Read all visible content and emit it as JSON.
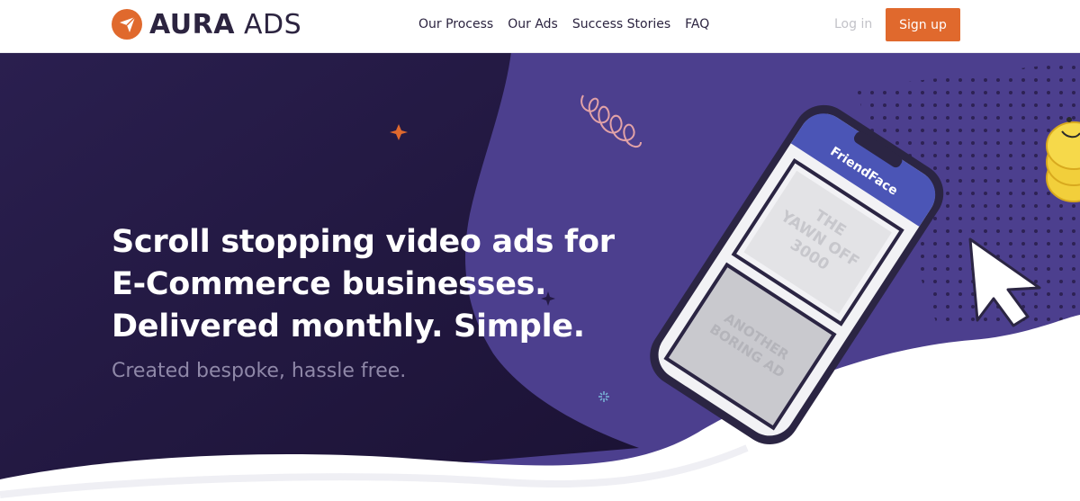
{
  "brand": {
    "name_bold": "AURA",
    "name_light": " ADS",
    "logo_icon": "paper-plane-icon",
    "accent": "#e0692d"
  },
  "nav": {
    "links": [
      {
        "label": "Our Process"
      },
      {
        "label": "Our Ads"
      },
      {
        "label": "Success Stories"
      },
      {
        "label": "FAQ"
      }
    ],
    "login_label": "Log in",
    "signup_label": "Sign up"
  },
  "hero": {
    "title_lines": [
      "Scroll stopping video ads for",
      "E-Commerce businesses.",
      "Delivered monthly. Simple."
    ],
    "subtitle": "Created bespoke, hassle free.",
    "colors": {
      "dark": "#21173f",
      "purple": "#4c3f8e",
      "button": "#e0692d"
    }
  },
  "phone": {
    "app_name": "FriendFace",
    "ad_1_lines": [
      "THE",
      "YAWN OFF",
      "3000"
    ],
    "ad_2_lines": [
      "ANOTHER",
      "BORING AD"
    ]
  }
}
